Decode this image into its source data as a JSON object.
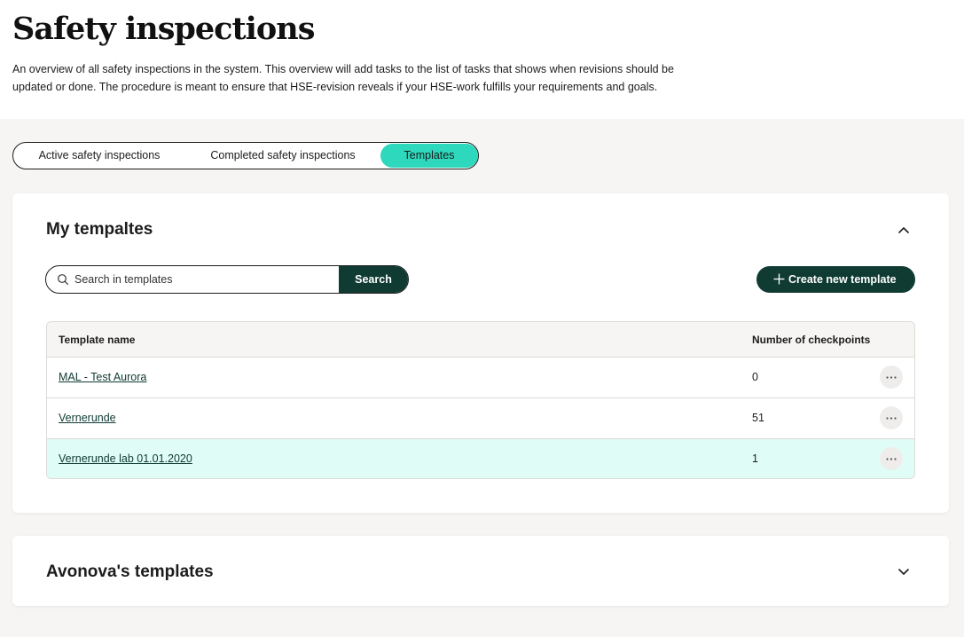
{
  "page": {
    "title": "Safety inspections",
    "description": "An overview of all safety inspections in the system. This overview will add tasks to the list of tasks that shows when revisions should be updated or done. The procedure is meant to ensure that HSE-revision reveals if your HSE-work fulfills your requirements and goals."
  },
  "tabs": [
    {
      "label": "Active safety inspections",
      "active": false
    },
    {
      "label": "Completed safety inspections",
      "active": false
    },
    {
      "label": "Templates",
      "active": true
    }
  ],
  "my_templates": {
    "title": "My tempaltes",
    "expanded": true,
    "search": {
      "placeholder": "Search in templates",
      "button_label": "Search"
    },
    "create_button_label": "Create new template",
    "columns": [
      "Template name",
      "Number of checkpoints"
    ],
    "rows": [
      {
        "name": "MAL - Test Aurora",
        "checkpoints": "0"
      },
      {
        "name": "Vernerunde",
        "checkpoints": "51"
      },
      {
        "name": "Vernerunde lab 01.01.2020",
        "checkpoints": "1",
        "highlighted": true
      }
    ]
  },
  "avonova_templates": {
    "title": "Avonova's templates",
    "expanded": false
  },
  "colors": {
    "accent": "#2ed8bc",
    "primary_dark": "#0f3b33",
    "highlight_row": "#e0fcf6",
    "background": "#f7f5f3"
  },
  "icons": {
    "search": "search-icon",
    "plus": "plus-icon",
    "more": "more-horizontal-icon",
    "collapse": "chevron-up-icon",
    "expand": "chevron-down-icon"
  }
}
